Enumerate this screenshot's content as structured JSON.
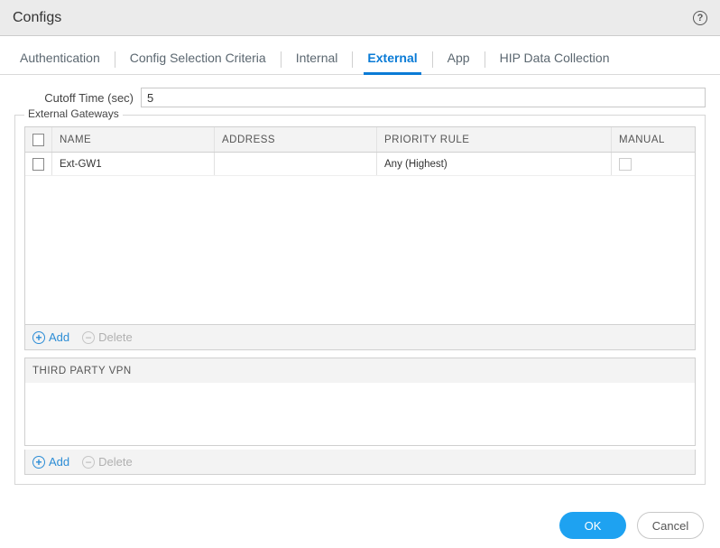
{
  "title": "Configs",
  "tabs": [
    "Authentication",
    "Config Selection Criteria",
    "Internal",
    "External",
    "App",
    "HIP Data Collection"
  ],
  "active_tab_index": 3,
  "cutoff": {
    "label": "Cutoff Time (sec)",
    "value": "5"
  },
  "ext_gw": {
    "legend": "External Gateways",
    "columns": [
      "NAME",
      "ADDRESS",
      "PRIORITY RULE",
      "MANUAL"
    ],
    "rows": [
      {
        "name": "Ext-GW1",
        "address": "",
        "priority": "Any (Highest)",
        "manual": false
      }
    ],
    "add": "Add",
    "delete": "Delete"
  },
  "third_party": {
    "header": "THIRD PARTY VPN",
    "add": "Add",
    "delete": "Delete"
  },
  "footer": {
    "ok": "OK",
    "cancel": "Cancel"
  }
}
